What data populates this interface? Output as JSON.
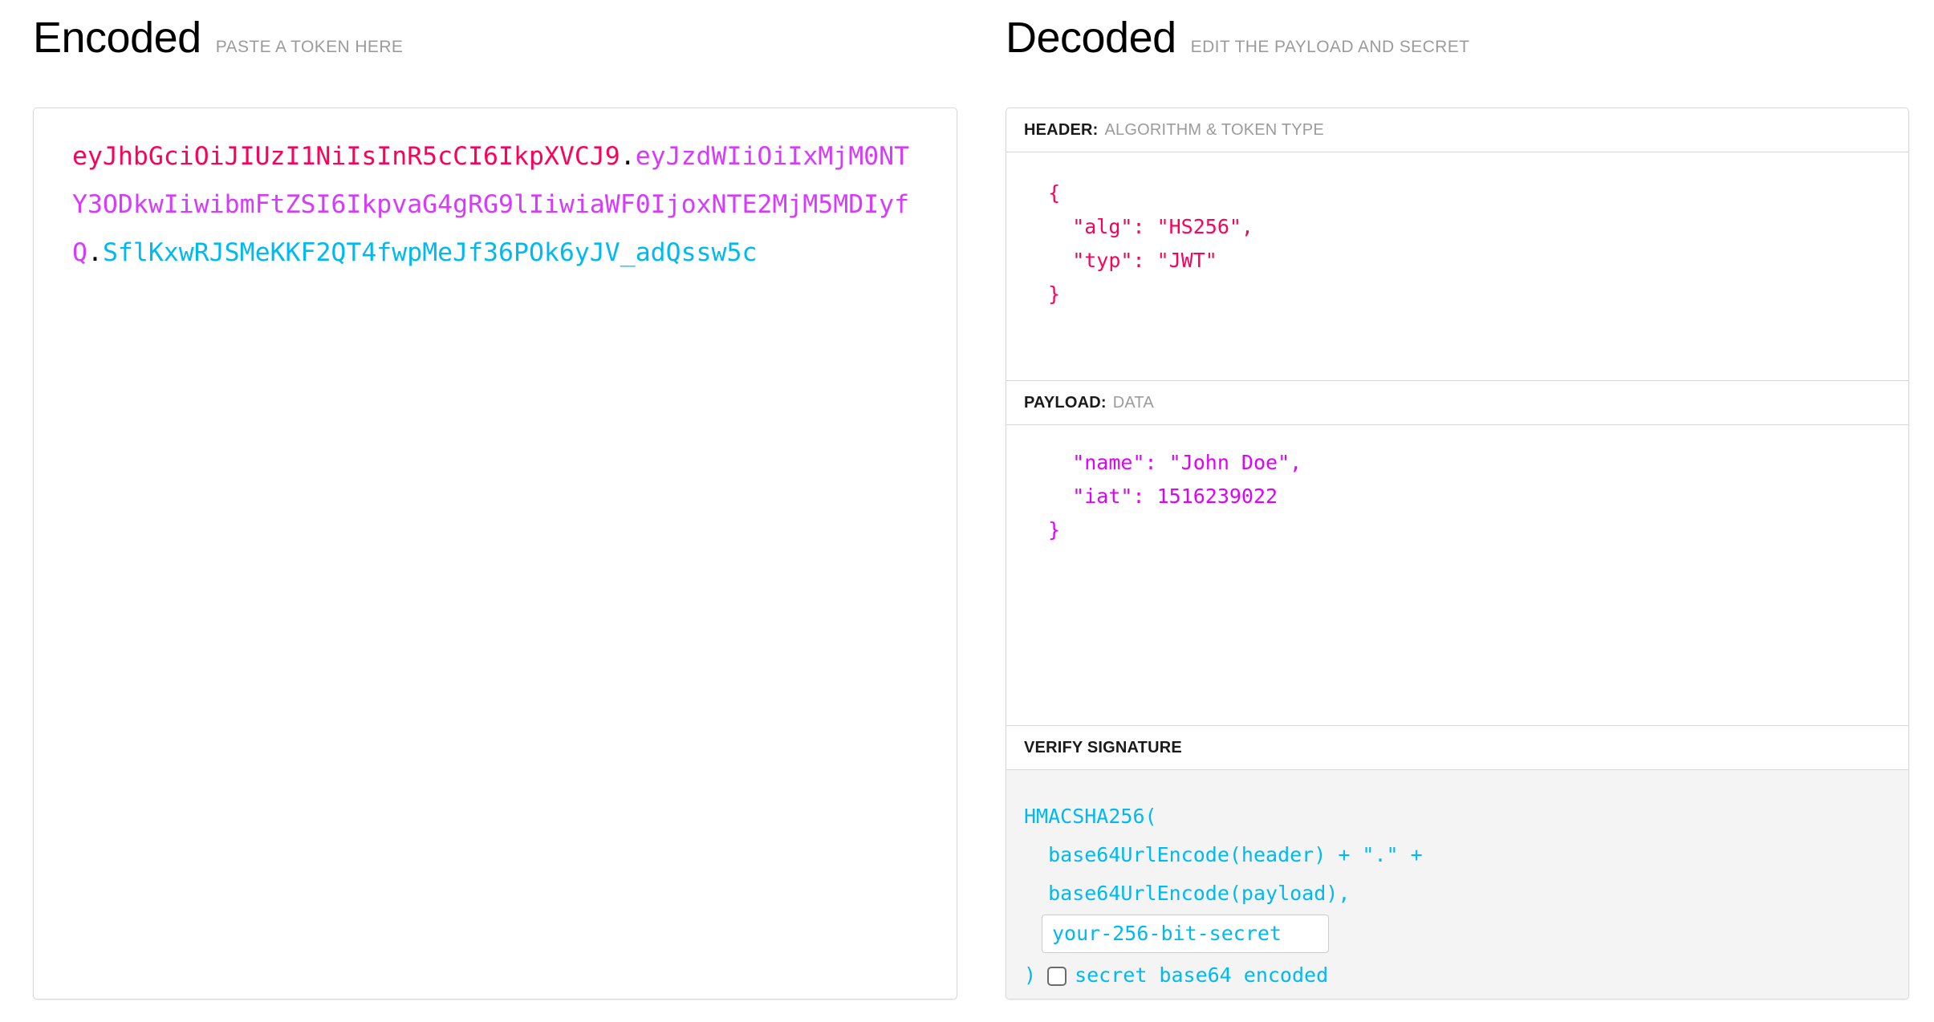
{
  "encoded": {
    "title": "Encoded",
    "subtitle": "PASTE A TOKEN HERE",
    "token": {
      "header_segment": "eyJhbGciOiJIUzI1NiIsInR5cCI6IkpXVCJ9",
      "dot1": ".",
      "payload_segment": "eyJzdWIiOiIxMjM0NTY3ODkwIiwibmFtZSI6IkpvaG4gRG9lIiwiaWF0IjoxNTE2MjM5MDIyfQ",
      "dot2": ".",
      "signature_segment": "SflKxwRJSMeKKF2QT4fwpMeJf36POk6yJV_adQssw5c"
    },
    "colors": {
      "header": "#fb015b",
      "payload": "#d63aff",
      "signature": "#00b9f1",
      "separator": "#000000"
    }
  },
  "decoded": {
    "title": "Decoded",
    "subtitle": "EDIT THE PAYLOAD AND SECRET",
    "sections": {
      "header": {
        "label": "HEADER:",
        "hint": "ALGORITHM & TOKEN TYPE",
        "content": "  {\n    \"alg\": \"HS256\",\n    \"typ\": \"JWT\"\n  }",
        "color": "#fb015b"
      },
      "payload": {
        "label": "PAYLOAD:",
        "hint": "DATA",
        "content": "    \"name\": \"John Doe\",\n    \"iat\": 1516239022\n  }",
        "color": "#e000ff"
      },
      "signature": {
        "label": "VERIFY SIGNATURE",
        "hint": "",
        "color": "#00b9f1",
        "line1": "HMACSHA256(",
        "line2": "  base64UrlEncode(header) + \".\" +",
        "line3": "  base64UrlEncode(payload),",
        "secret_value": "your-256-bit-secret",
        "secret_placeholder": "your-256-bit-secret",
        "closing_paren": ")",
        "base64_label": "secret base64 encoded",
        "base64_checked": false
      }
    }
  }
}
